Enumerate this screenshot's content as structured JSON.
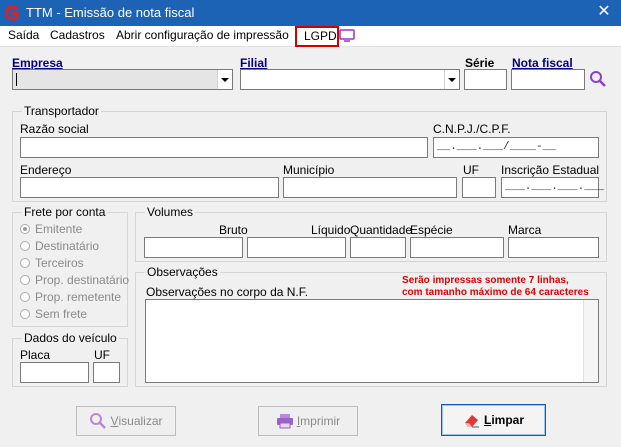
{
  "window": {
    "title": "TTM - Emissão de nota fiscal",
    "close_glyph": "✕"
  },
  "menu": {
    "items": [
      "Saída",
      "Cadastros",
      "Abrir configuração de impressão",
      "LGPD"
    ]
  },
  "top": {
    "empresa_label": "Empresa",
    "filial_label": "Filial",
    "serie_label": "Série",
    "nota_label": "Nota fiscal"
  },
  "transportador": {
    "title": "Transportador",
    "razao_label": "Razão social",
    "cnpj_label": "C.N.P.J./C.P.F.",
    "cnpj_mask": "__.___.___/____-__",
    "endereco_label": "Endereço",
    "municipio_label": "Município",
    "uf_label": "UF",
    "ie_label": "Inscrição Estadual",
    "ie_mask": "___.___.___.___"
  },
  "frete": {
    "title": "Frete por conta",
    "options": [
      "Emitente",
      "Destinatário",
      "Terceiros",
      "Prop. destinatário",
      "Prop. remetente",
      "Sem frete"
    ],
    "selected": "Emitente"
  },
  "volumes": {
    "title": "Volumes",
    "bruto_label": "Bruto",
    "liquido_label": "Líquido",
    "quantidade_label": "Quantidade",
    "especie_label": "Espécie",
    "marca_label": "Marca"
  },
  "observacoes": {
    "title": "Observações",
    "corpo_label": "Observações no corpo da N.F.",
    "note_line1": "Serão impressas somente 7 linhas,",
    "note_line2": "com tamanho máximo de 64 caracteres"
  },
  "veiculo": {
    "title": "Dados do veículo",
    "placa_label": "Placa",
    "uf_label": "UF"
  },
  "buttons": {
    "visualizar_first": "V",
    "visualizar_rest": "isualizar",
    "imprimir_first": "I",
    "imprimir_rest": "mprimir",
    "limpar_first": "L",
    "limpar_rest": "impar"
  },
  "icons": [
    "app-logo-icon",
    "close-icon",
    "monitor-icon",
    "search-icon",
    "magnifier-icon",
    "printer-icon",
    "eraser-icon"
  ],
  "colors": {
    "titlebar": "#1c63b6",
    "accent_label": "#000080",
    "note": "#e00000",
    "highlight_box": "#d40000"
  }
}
